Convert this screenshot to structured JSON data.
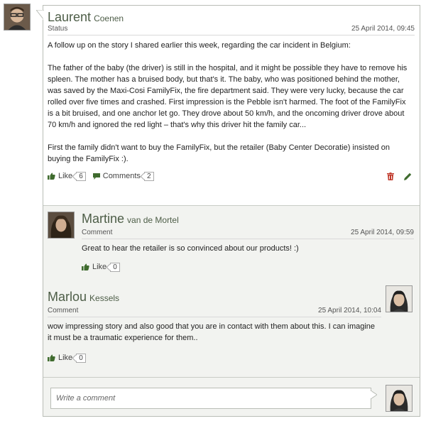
{
  "post": {
    "author_first": "Laurent",
    "author_last": "Coenen",
    "type": "Status",
    "timestamp": "25 April 2014, 09:45",
    "paragraphs": [
      "A follow up on the story I shared earlier this week, regarding the car incident in Belgium:",
      "The father of the baby (the driver) is still in the hospital, and it might be possible they have to remove his spleen. The mother has a bruised body, but that's it. The baby, who was positioned behind the mother, was saved by the Maxi-Cosi FamilyFix, the fire department said. They were very lucky, because the car rolled over five times and crashed. First impression is the Pebble isn't harmed. The foot of the FamilyFix is a bit bruised, and one anchor let go. They drove about 50 km/h, and the oncoming driver drove about 70 km/h and ignored the red light – that's why this driver hit the family car...",
      "First the family didn't want to buy the FamilyFix, but the retailer (Baby Center Decoratie) insisted on buying the FamilyFix :)."
    ],
    "like_label": "Like",
    "like_count": "6",
    "comments_label": "Comments",
    "comments_count": "2"
  },
  "comments": [
    {
      "author_first": "Martine",
      "author_last": "van de Mortel",
      "type": "Comment",
      "timestamp": "25 April 2014, 09:59",
      "text": "Great to hear the retailer is so convinced about our products! :)",
      "like_label": "Like",
      "like_count": "0"
    },
    {
      "author_first": "Marlou",
      "author_last": "Kessels",
      "type": "Comment",
      "timestamp": "25 April 2014, 10:04",
      "text": "wow impressing story and also good that you are in contact with them about this. I can imagine it must be a traumatic experience for them..",
      "like_label": "Like",
      "like_count": "0"
    }
  ],
  "composer": {
    "placeholder": "Write a comment"
  },
  "icons": {
    "like": "thumbs-up-icon",
    "comments": "speech-bubble-icon",
    "delete": "trash-icon",
    "edit": "pencil-icon"
  },
  "colors": {
    "accent": "#4d5d47",
    "icon_green": "#3f6b2e",
    "delete_red": "#c0392b",
    "comments_bg": "#f2f3f0"
  }
}
